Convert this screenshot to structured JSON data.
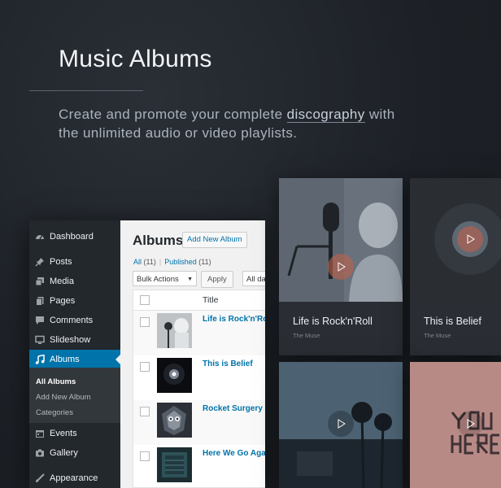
{
  "hero": {
    "title": "Music Albums",
    "desc_before": "Create and promote your complete ",
    "desc_link": "discography",
    "desc_after": " with the unlimited audio or video playlists."
  },
  "sidebar": {
    "items": [
      {
        "label": "Dashboard",
        "icon": "dashboard-icon"
      },
      {
        "label": "Posts",
        "icon": "pin-icon"
      },
      {
        "label": "Media",
        "icon": "media-icon"
      },
      {
        "label": "Pages",
        "icon": "pages-icon"
      },
      {
        "label": "Comments",
        "icon": "comment-icon"
      },
      {
        "label": "Slideshow",
        "icon": "monitor-icon"
      },
      {
        "label": "Albums",
        "icon": "music-note-icon"
      },
      {
        "label": "Events",
        "icon": "calendar-icon"
      },
      {
        "label": "Gallery",
        "icon": "camera-icon"
      },
      {
        "label": "Appearance",
        "icon": "brush-icon"
      }
    ],
    "submenu": [
      "All Albums",
      "Add New Album",
      "Categories"
    ]
  },
  "content": {
    "title": "Albums",
    "add_new": "Add New Album",
    "filter_all": "All",
    "filter_all_count": "(11)",
    "filter_published": "Published",
    "filter_published_count": "(11)",
    "bulk_actions": "Bulk Actions",
    "apply": "Apply",
    "dates": "All da",
    "column_title": "Title",
    "rows": [
      "Life is Rock'n'Roll",
      "This is Belief",
      "Rocket Surgery",
      "Here We Go Again"
    ]
  },
  "cards": [
    {
      "title": "Life is Rock'n'Roll",
      "artist": "The Muse"
    },
    {
      "title": "This is Belief",
      "artist": "The Muse"
    },
    {
      "title": "",
      "artist": ""
    },
    {
      "title": "",
      "artist": ""
    }
  ],
  "colors": {
    "accent": "#0073aa",
    "play": "#c0614a",
    "sidebar": "#23282d"
  }
}
